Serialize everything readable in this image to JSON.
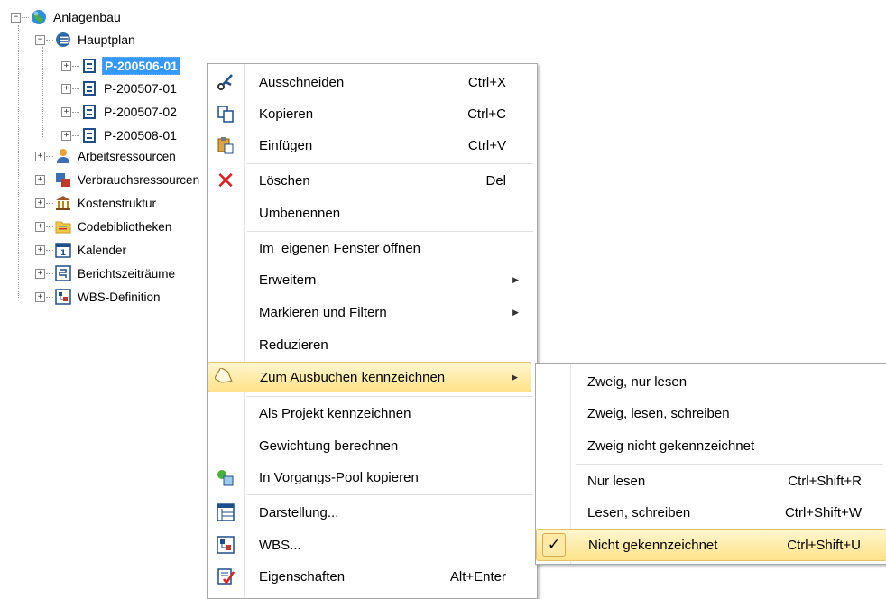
{
  "tree": {
    "root": "Anlagenbau",
    "plan": "Hauptplan",
    "projects": [
      "P-200506-01",
      "P-200507-01",
      "P-200507-02",
      "P-200508-01"
    ],
    "items": [
      "Arbeitsressourcen",
      "Verbrauchsressourcen",
      "Kostenstruktur",
      "Codebibliotheken",
      "Kalender",
      "Berichtszeiträume",
      "WBS-Definition"
    ]
  },
  "context_menu": {
    "cut": {
      "label": "Ausschneiden",
      "key": "Ctrl+X"
    },
    "copy": {
      "label": "Kopieren",
      "key": "Ctrl+C"
    },
    "paste": {
      "label": "Einfügen",
      "key": "Ctrl+V"
    },
    "delete": {
      "label": "Löschen",
      "key": "Del"
    },
    "rename": {
      "label": "Umbenennen"
    },
    "open_window": {
      "label": "Im  eigenen Fenster öffnen"
    },
    "expand": {
      "label": "Erweitern"
    },
    "mark_filter": {
      "label": "Markieren und Filtern"
    },
    "reduce": {
      "label": "Reduzieren"
    },
    "checkout": {
      "label": "Zum Ausbuchen kennzeichnen"
    },
    "mark_project": {
      "label": "Als Projekt kennzeichnen"
    },
    "weighting": {
      "label": "Gewichtung berechnen"
    },
    "pool_copy": {
      "label": "In Vorgangs-Pool kopieren"
    },
    "display": {
      "label": "Darstellung..."
    },
    "wbs": {
      "label": "WBS..."
    },
    "properties": {
      "label": "Eigenschaften",
      "key": "Alt+Enter"
    }
  },
  "submenu": {
    "branch_read": {
      "label": "Zweig, nur lesen"
    },
    "branch_rw": {
      "label": "Zweig, lesen, schreiben"
    },
    "branch_none": {
      "label": "Zweig nicht gekennzeichnet"
    },
    "read_only": {
      "label": "Nur lesen",
      "key": "Ctrl+Shift+R"
    },
    "read_write": {
      "label": "Lesen, schreiben",
      "key": "Ctrl+Shift+W"
    },
    "not_marked": {
      "label": "Nicht gekennzeichnet",
      "key": "Ctrl+Shift+U",
      "checked": true
    }
  },
  "colors": {
    "selection": "#3399ff",
    "highlight": "#ffe38a",
    "delete": "#e02020"
  }
}
